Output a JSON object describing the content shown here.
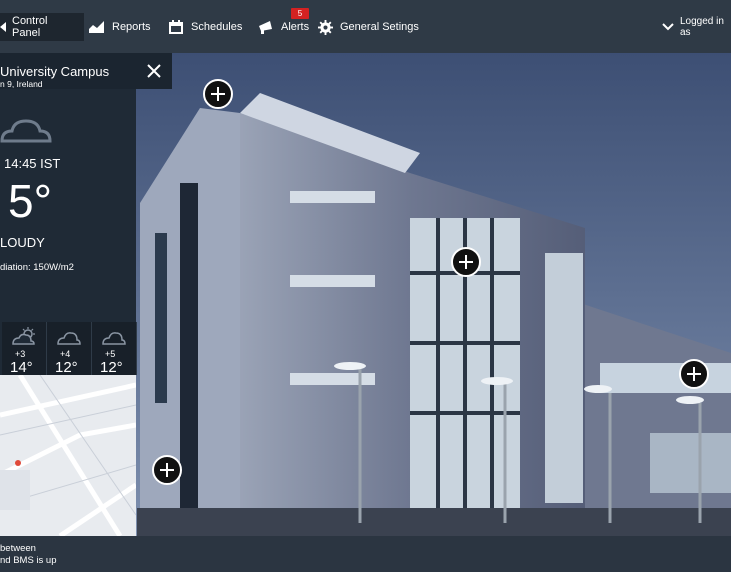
{
  "nav": {
    "control_panel": "Control Panel",
    "reports": "Reports",
    "schedules": "Schedules",
    "alerts": "Alerts",
    "alerts_count": "5",
    "general_settings": "General Setings",
    "user": "Logged in as"
  },
  "weather": {
    "location": "University Campus",
    "sublocation": "n 9, Ireland",
    "time": "14:45 IST",
    "temperature": "5°",
    "condition": "LOUDY",
    "radiation": "diation: 150W/m2",
    "forecast": [
      {
        "offset": "+3",
        "temp": "14°",
        "icon": "partly-sunny-icon"
      },
      {
        "offset": "+4",
        "temp": "12°",
        "icon": "cloud-icon"
      },
      {
        "offset": "+5",
        "temp": "12°",
        "icon": "cloud-icon"
      }
    ]
  },
  "footer": {
    "line1": "between",
    "line2": "nd BMS is up"
  },
  "colors": {
    "topbar": "#2f3a46",
    "panel": "#1f2a36",
    "badge": "#d32222"
  }
}
